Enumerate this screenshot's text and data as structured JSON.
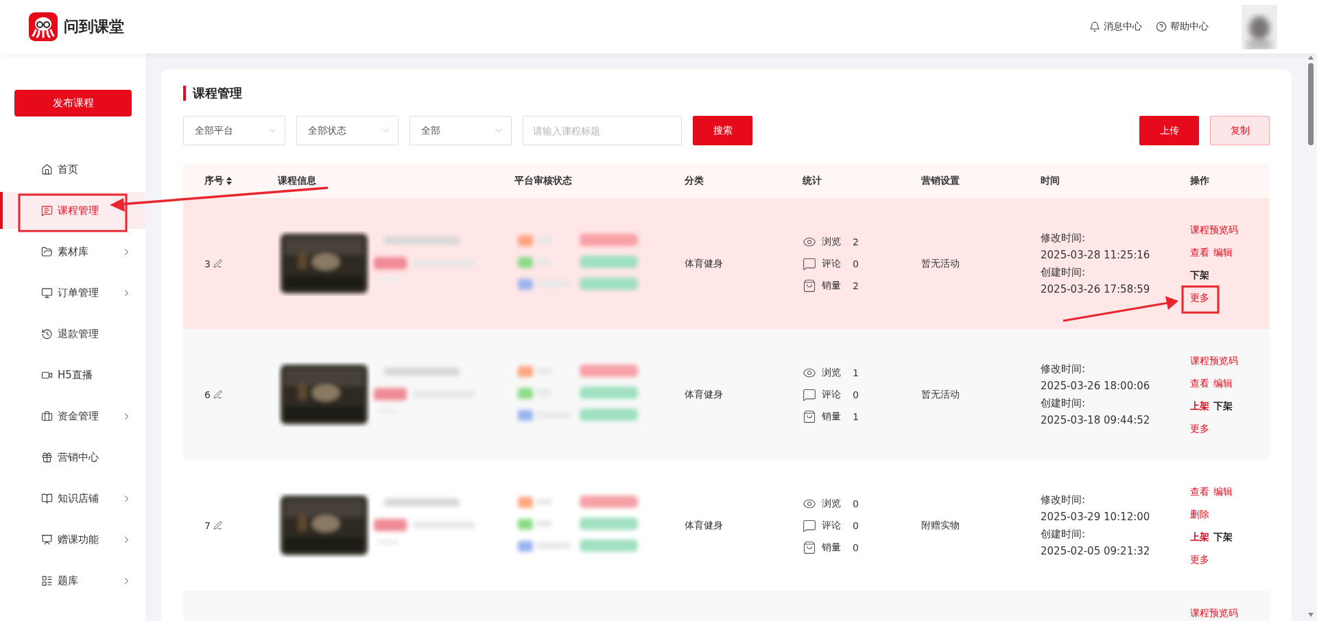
{
  "header": {
    "brand": "问到课堂",
    "links": [
      {
        "label": "消息中心"
      },
      {
        "label": "帮助中心"
      }
    ]
  },
  "sidebar": {
    "publish_button": "发布课程",
    "items": [
      {
        "label": "首页",
        "selected": false,
        "expandable": false
      },
      {
        "label": "课程管理",
        "selected": true,
        "expandable": false
      },
      {
        "label": "素材库",
        "selected": false,
        "expandable": true
      },
      {
        "label": "订单管理",
        "selected": false,
        "expandable": true
      },
      {
        "label": "退款管理",
        "selected": false,
        "expandable": false
      },
      {
        "label": "H5直播",
        "selected": false,
        "expandable": false
      },
      {
        "label": "资金管理",
        "selected": false,
        "expandable": true
      },
      {
        "label": "营销中心",
        "selected": false,
        "expandable": false
      },
      {
        "label": "知识店铺",
        "selected": false,
        "expandable": true
      },
      {
        "label": "赠课功能",
        "selected": false,
        "expandable": true
      },
      {
        "label": "题库",
        "selected": false,
        "expandable": true
      }
    ]
  },
  "page": {
    "title": "课程管理",
    "filters": [
      {
        "value": "全部平台"
      },
      {
        "value": "全部状态"
      },
      {
        "value": "全部"
      }
    ],
    "search": {
      "placeholder": "请输入课程标题",
      "button": "搜索"
    },
    "actions": [
      {
        "label": "上传",
        "kind": "primary"
      },
      {
        "label": "复制",
        "kind": "secondary"
      }
    ]
  },
  "table": {
    "columns": [
      "序号",
      "课程信息",
      "平台审核状态",
      "分类",
      "统计",
      "营销设置",
      "时间",
      "操作"
    ],
    "rows": [
      {
        "selected": true,
        "number": "3",
        "category": "体育健身",
        "stats": [
          {
            "label": "浏览",
            "value": "2"
          },
          {
            "label": "评论",
            "value": "0"
          },
          {
            "label": "销量",
            "value": "2"
          }
        ],
        "marketing": "暂无活动",
        "modified_label": "修改时间:",
        "modified": "2025-03-28 11:25:16",
        "created_label": "创建时间:",
        "created": "2025-03-26 17:58:59",
        "actions": [
          [
            {
              "label": "课程预览码",
              "kind": "link"
            }
          ],
          [
            {
              "label": "查看",
              "kind": "link"
            },
            {
              "label": "编辑",
              "kind": "link"
            }
          ],
          [
            {
              "label": "下架",
              "kind": "unpublish"
            }
          ],
          [
            {
              "label": "更多",
              "kind": "link"
            }
          ]
        ]
      },
      {
        "selected": false,
        "number": "6",
        "category": "体育健身",
        "stats": [
          {
            "label": "浏览",
            "value": "1"
          },
          {
            "label": "评论",
            "value": "0"
          },
          {
            "label": "销量",
            "value": "1"
          }
        ],
        "marketing": "暂无活动",
        "modified_label": "修改时间:",
        "modified": "2025-03-26 18:00:06",
        "created_label": "创建时间:",
        "created": "2025-03-18 09:44:52",
        "actions": [
          [
            {
              "label": "课程预览码",
              "kind": "link"
            }
          ],
          [
            {
              "label": "查看",
              "kind": "link"
            },
            {
              "label": "编辑",
              "kind": "link"
            }
          ],
          [
            {
              "label": "上架",
              "kind": "publish"
            },
            {
              "label": "下架",
              "kind": "unpublish"
            }
          ],
          [
            {
              "label": "更多",
              "kind": "link"
            }
          ]
        ]
      },
      {
        "selected": false,
        "number": "7",
        "category": "体育健身",
        "stats": [
          {
            "label": "浏览",
            "value": "0"
          },
          {
            "label": "评论",
            "value": "0"
          },
          {
            "label": "销量",
            "value": "0"
          }
        ],
        "marketing": "附赠实物",
        "modified_label": "修改时间:",
        "modified": "2025-03-29 10:12:00",
        "created_label": "创建时间:",
        "created": "2025-02-05 09:21:32",
        "actions": [
          [
            {
              "label": "查看",
              "kind": "link"
            },
            {
              "label": "编辑",
              "kind": "link"
            }
          ],
          [
            {
              "label": "删除",
              "kind": "link"
            }
          ],
          [
            {
              "label": "上架",
              "kind": "publish"
            },
            {
              "label": "下架",
              "kind": "unpublish"
            }
          ],
          [
            {
              "label": "更多",
              "kind": "link"
            }
          ]
        ]
      },
      {
        "selected": false,
        "actions": [
          [
            {
              "label": "课程预览码",
              "kind": "link"
            }
          ]
        ]
      }
    ]
  }
}
